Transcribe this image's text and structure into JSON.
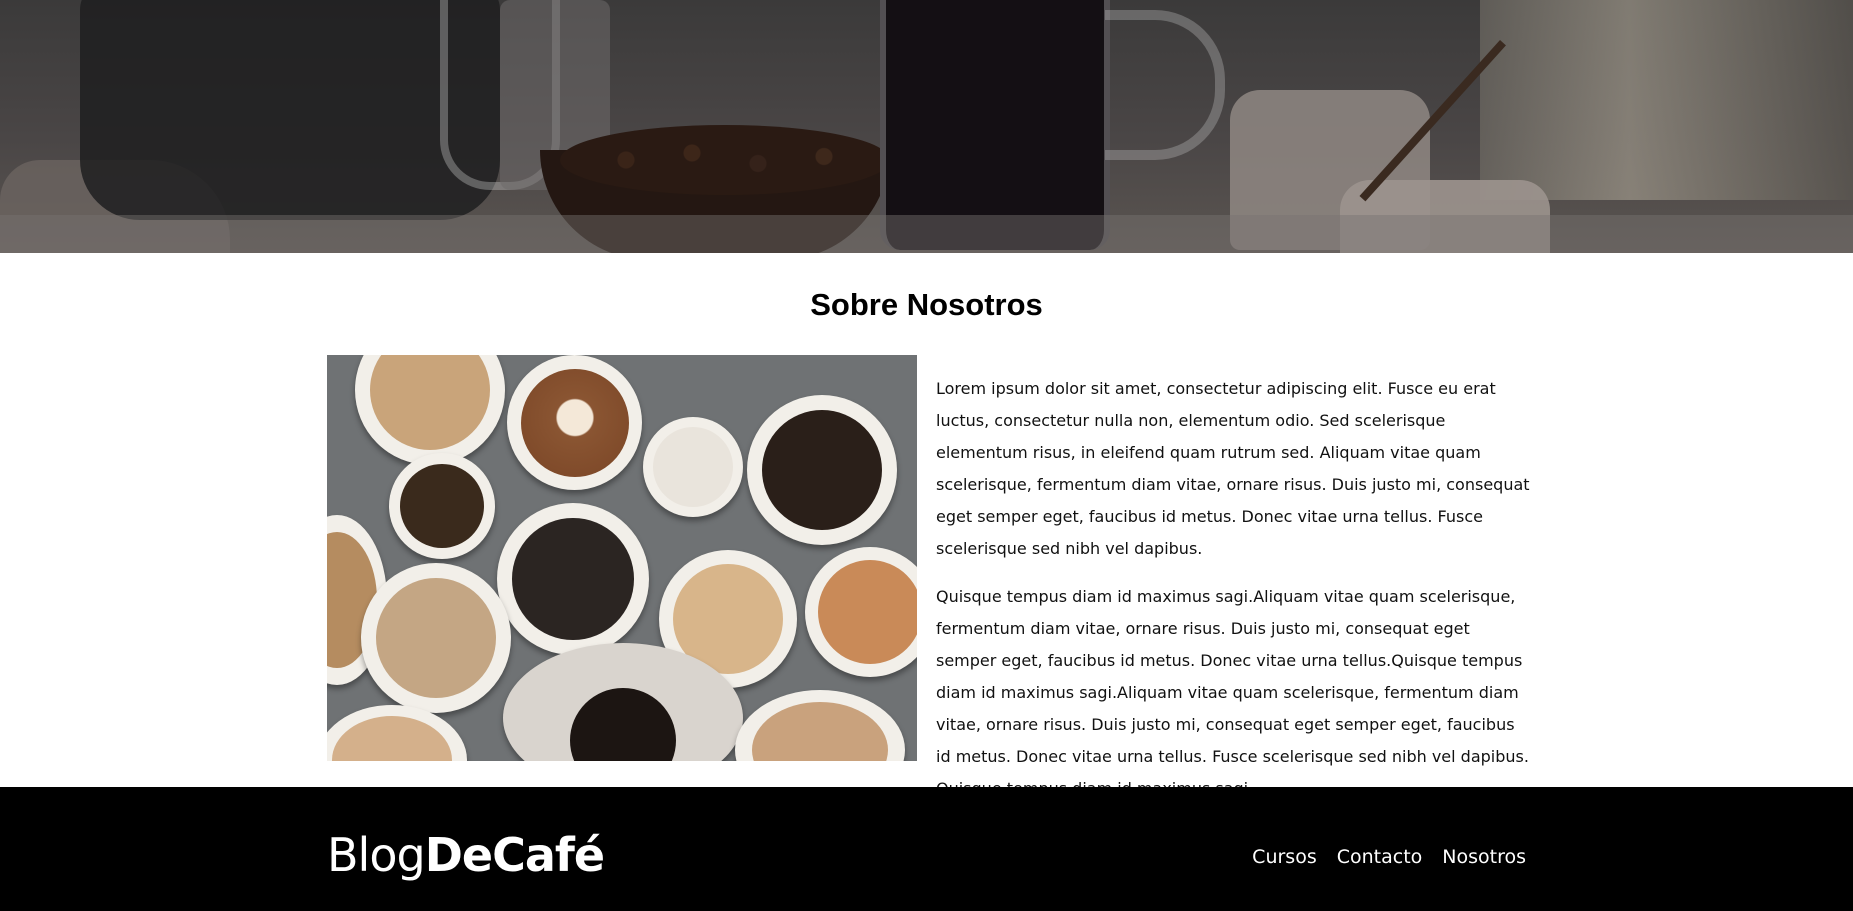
{
  "hero": {
    "image_icon": "coffee-scene-image"
  },
  "about": {
    "title": "Sobre Nosotros",
    "image_icon": "coffee-cups-image",
    "paragraphs": [
      "Lorem ipsum dolor sit amet, consectetur adipiscing elit. Fusce eu erat luctus, consectetur nulla non, elementum odio. Sed scelerisque elementum risus, in eleifend quam rutrum sed. Aliquam vitae quam scelerisque, fermentum diam vitae, ornare risus. Duis justo mi, consequat eget semper eget, faucibus id metus. Donec vitae urna tellus. Fusce scelerisque sed nibh vel dapibus.",
      "Quisque tempus diam id maximus sagi.Aliquam vitae quam scelerisque, fermentum diam vitae, ornare risus. Duis justo mi, consequat eget semper eget, faucibus id metus. Donec vitae urna tellus.Quisque tempus diam id maximus sagi.Aliquam vitae quam scelerisque, fermentum diam vitae, ornare risus. Duis justo mi, consequat eget semper eget, faucibus id metus. Donec vitae urna tellus. Fusce scelerisque sed nibh vel dapibus. Quisque tempus diam id maximus sagi."
    ]
  },
  "footer": {
    "logo_light": "Blog",
    "logo_bold": "DeCafé",
    "nav": [
      {
        "label": "Cursos"
      },
      {
        "label": "Contacto"
      },
      {
        "label": "Nosotros"
      }
    ]
  },
  "colors": {
    "footer_bg": "#000000",
    "text": "#111111",
    "background": "#ffffff"
  }
}
